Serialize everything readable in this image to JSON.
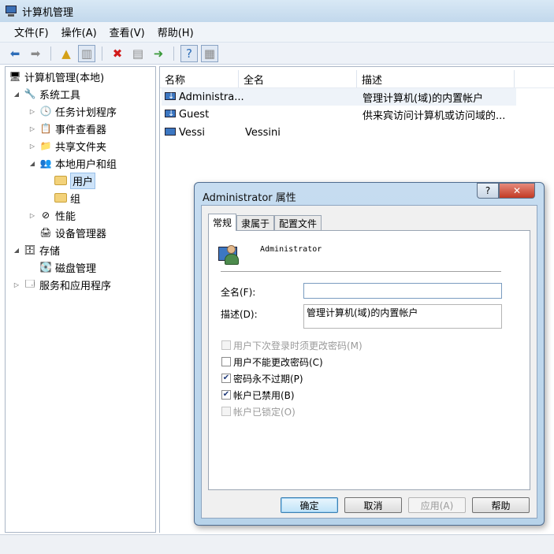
{
  "window": {
    "title": "计算机管理"
  },
  "menu": [
    "文件(F)",
    "操作(A)",
    "查看(V)",
    "帮助(H)"
  ],
  "tree": {
    "root": "计算机管理(本地)",
    "system_tools": "系统工具",
    "task_scheduler": "任务计划程序",
    "event_viewer": "事件查看器",
    "shared_folders": "共享文件夹",
    "local_users_groups": "本地用户和组",
    "users": "用户",
    "groups": "组",
    "performance": "性能",
    "device_manager": "设备管理器",
    "storage": "存储",
    "disk_management": "磁盘管理",
    "services_apps": "服务和应用程序"
  },
  "list": {
    "columns": [
      "名称",
      "全名",
      "描述"
    ],
    "rows": [
      {
        "name": "Administra...",
        "fullname": "",
        "desc": "管理计算机(域)的内置帐户"
      },
      {
        "name": "Guest",
        "fullname": "",
        "desc": "供来宾访问计算机或访问域的..."
      },
      {
        "name": "Vessi",
        "fullname": "Vessini",
        "desc": ""
      }
    ]
  },
  "dialog": {
    "title": "Administrator 属性",
    "help_glyph": "?",
    "close_glyph": "✕",
    "tabs": [
      "常规",
      "隶属于",
      "配置文件"
    ],
    "account_name": "Administrator",
    "fullname_label": "全名(F):",
    "fullname_value": "",
    "desc_label": "描述(D):",
    "desc_value": "管理计算机(域)的内置帐户",
    "checkboxes": [
      {
        "label": "用户下次登录时须更改密码(M)",
        "checked": false,
        "enabled": false
      },
      {
        "label": "用户不能更改密码(C)",
        "checked": false,
        "enabled": true
      },
      {
        "label": "密码永不过期(P)",
        "checked": true,
        "enabled": true
      },
      {
        "label": "帐户已禁用(B)",
        "checked": true,
        "enabled": true
      },
      {
        "label": "帐户已锁定(O)",
        "checked": false,
        "enabled": false
      }
    ],
    "buttons": {
      "ok": "确定",
      "cancel": "取消",
      "apply": "应用(A)",
      "help": "帮助"
    }
  }
}
